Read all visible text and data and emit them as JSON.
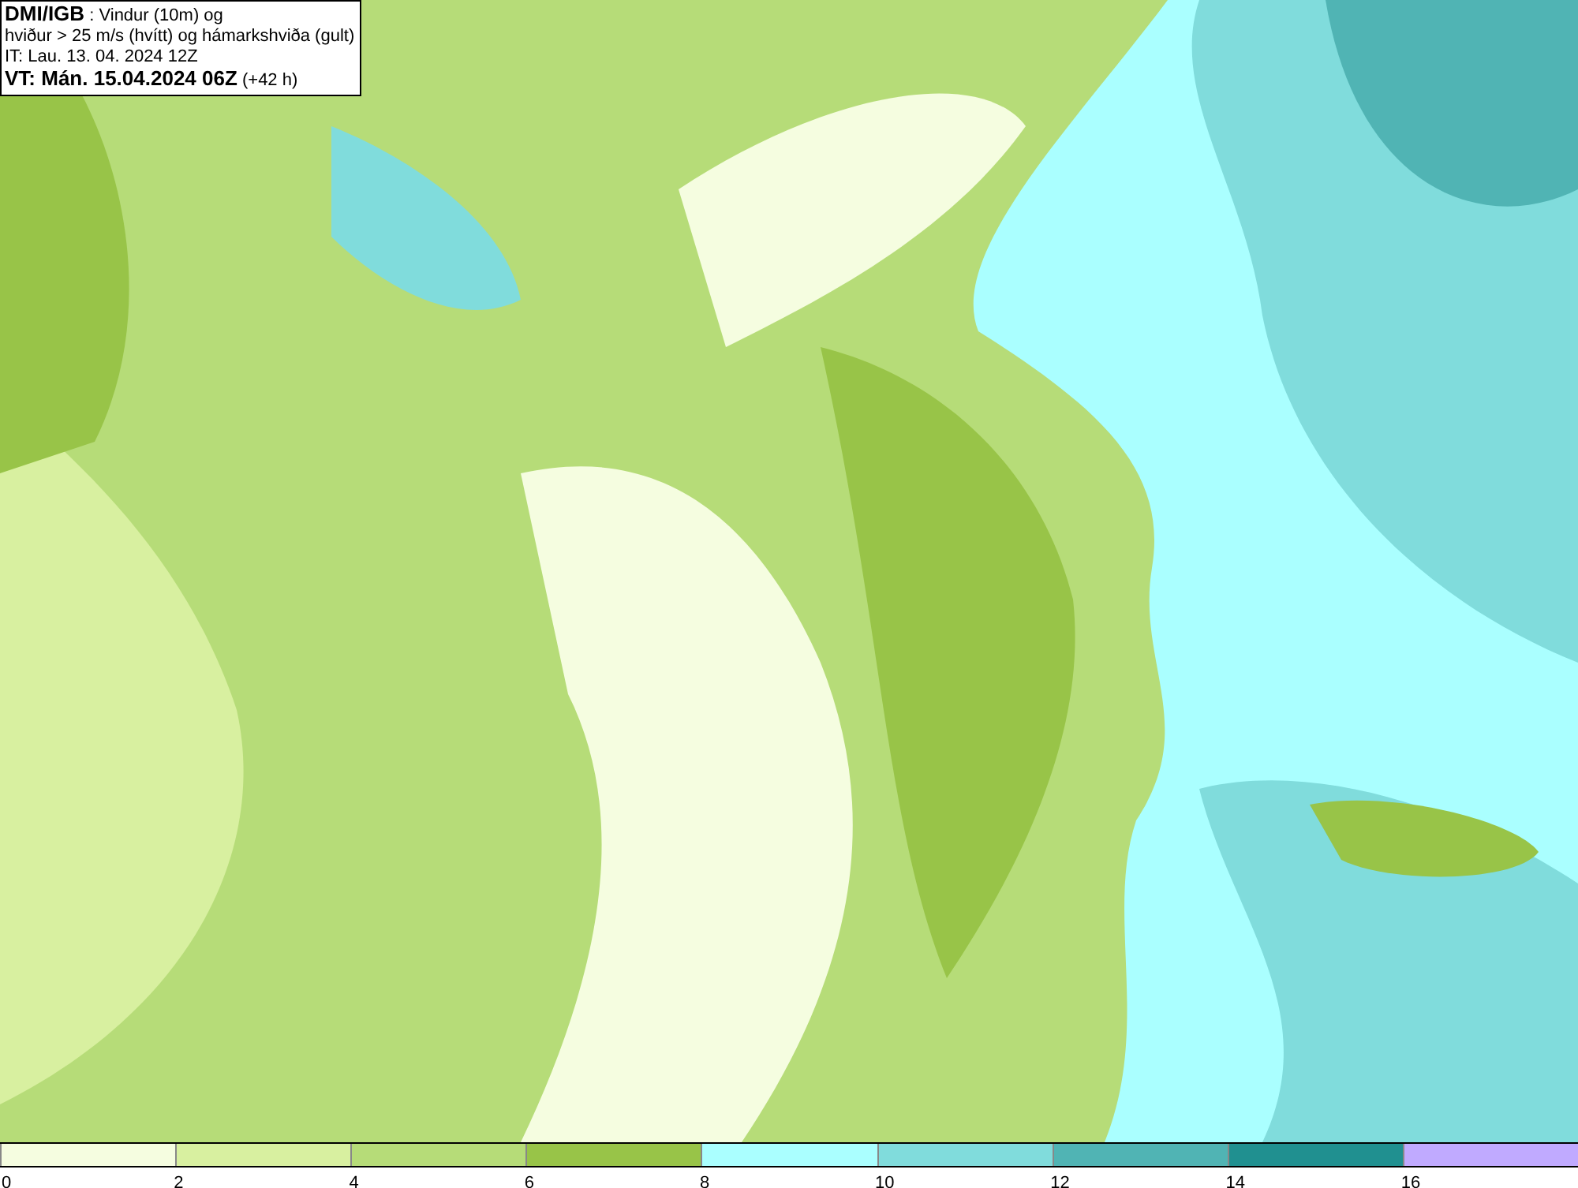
{
  "header": {
    "lines": [
      "**DMI/IGB** : Vindur (10m) og",
      "hviður > 25 m/s (hvítt) og hámarkshviða (gult)",
      "IT: Lau. 13. 04. 2024 12Z",
      "**VT: Mán. 15.04.2024 06Z** (+42 h)"
    ]
  },
  "legend": [
    {
      "color": "#f5fde0",
      "label": "0"
    },
    {
      "color": "#d8f0a0",
      "label": "2"
    },
    {
      "color": "#b6dc78",
      "label": "4"
    },
    {
      "color": "#98c448",
      "label": "6"
    },
    {
      "color": "#aaffff",
      "label": "8"
    },
    {
      "color": "#80dcdc",
      "label": "10"
    },
    {
      "color": "#50b4b4",
      "label": "12"
    },
    {
      "color": "#209090",
      "label": "14"
    },
    {
      "color": "#c0aaff",
      "label": "16"
    }
  ]
}
